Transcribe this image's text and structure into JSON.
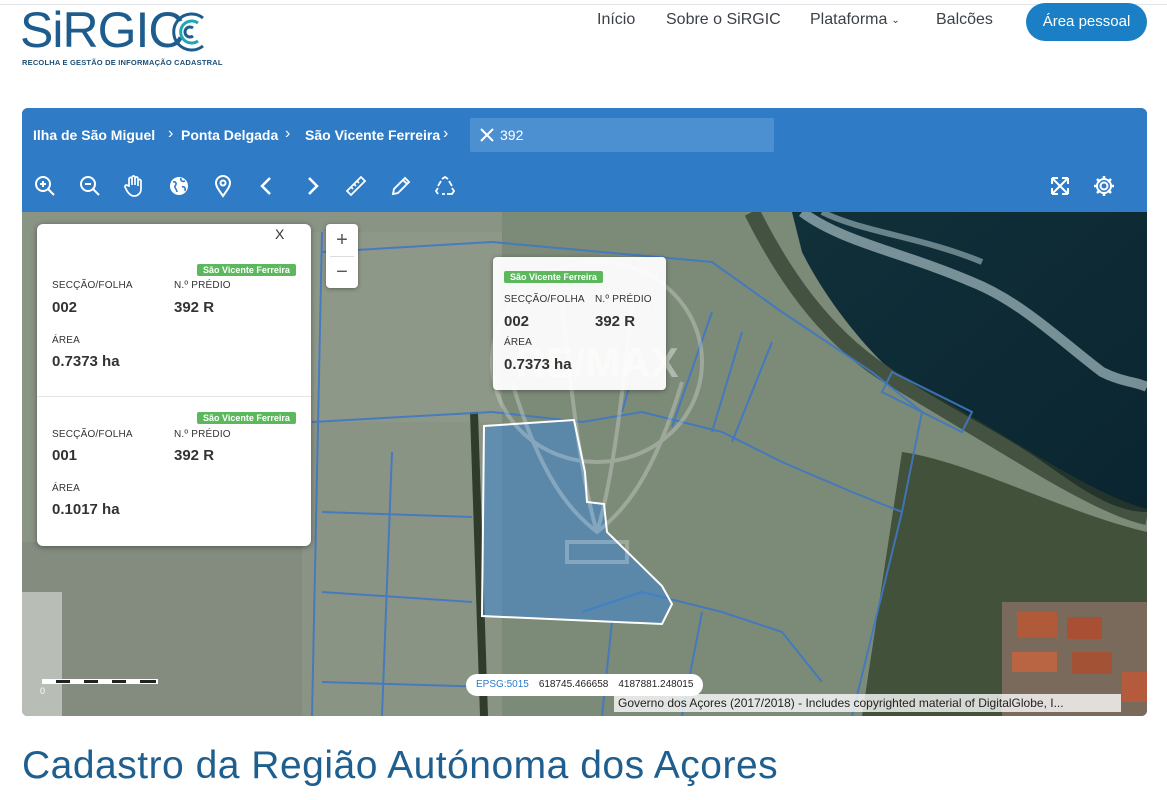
{
  "header": {
    "logo_word": "SiRGIC",
    "logo_tagline": "RECOLHA E GESTÃO DE INFORMAÇÃO CADASTRAL",
    "nav": [
      {
        "label": "Início"
      },
      {
        "label": "Sobre o SiRGIC"
      },
      {
        "label": "Plataforma",
        "has_dropdown": true
      },
      {
        "label": "Balcões"
      }
    ],
    "account_button": "Área pessoal",
    "accent_color": "#1a7fc4"
  },
  "map_panel": {
    "breadcrumb": [
      "Ilha de São Miguel",
      "Ponta Delgada",
      "São Vicente Ferreira"
    ],
    "search": {
      "value": "392"
    },
    "toolbar_icons": [
      "zoom-in-icon",
      "zoom-out-icon",
      "pan-hand-icon",
      "globe-icon",
      "location-pin-icon",
      "chevron-left-icon",
      "chevron-right-icon",
      "ruler-icon",
      "pencil-icon",
      "recycle-icon"
    ],
    "toolbar_right_icons": [
      "fullscreen-icon",
      "gear-icon"
    ],
    "zoom_control": {
      "plus": "+",
      "minus": "−"
    },
    "info_card": {
      "close_label": "X",
      "entries": [
        {
          "badge": "São Vicente Ferreira",
          "seccao_label": "SECÇÃO/FOLHA",
          "seccao": "002",
          "predio_label": "N.º PRÉDIO",
          "predio": "392 R",
          "area_label": "ÁREA",
          "area": "0.7373 ha"
        },
        {
          "badge": "São Vicente Ferreira",
          "seccao_label": "SECÇÃO/FOLHA",
          "seccao": "001",
          "predio_label": "N.º PRÉDIO",
          "predio": "392 R",
          "area_label": "ÁREA",
          "area": "0.1017 ha"
        }
      ]
    },
    "popup": {
      "badge": "São Vicente Ferreira",
      "seccao_label": "SECÇÃO/FOLHA",
      "seccao": "002",
      "predio_label": "N.º PRÉDIO",
      "predio": "392 R",
      "area_label": "ÁREA",
      "area": "0.7373 ha"
    },
    "watermark_text": "RE/MAX",
    "scale": {
      "zero": "0"
    },
    "coords": {
      "epsg": "EPSG:5015",
      "x": "618745.466658",
      "y": "4187881.248015"
    },
    "attribution": "Governo dos Açores (2017/2018) - Includes copyrighted material of DigitalGlobe, I..."
  },
  "page_title": "Cadastro da Região Autónoma dos Açores"
}
